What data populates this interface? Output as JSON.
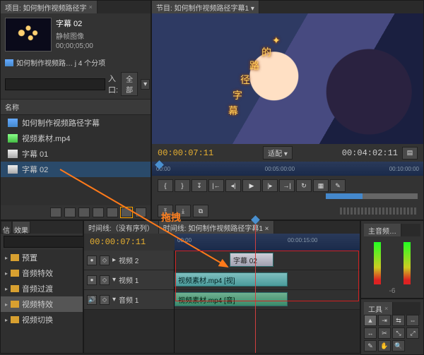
{
  "project": {
    "tab": "项目: 如何制作视频路径字",
    "clip": {
      "name": "字幕 02",
      "kind": "静帧图像",
      "dur": "00;00;05;00"
    },
    "bin_line": "如何制作视频路… j   4 个分项",
    "search_ph": "",
    "entry_label": "入口:",
    "entry_value": "全部",
    "col_name": "名称",
    "assets": [
      {
        "icon": "prj",
        "label": "如何制作视频路径字幕"
      },
      {
        "icon": "vid",
        "label": "视频素材.mp4"
      },
      {
        "icon": "ttl",
        "label": "字幕 01"
      },
      {
        "icon": "ttl",
        "label": "字幕 02",
        "sel": true
      }
    ]
  },
  "program": {
    "tab": "节目: 如何制作视频路径字幕1 ▾",
    "tc_current": "00:00:07:11",
    "fit": "适配",
    "tc_total": "00:04:02:11",
    "ruler": [
      "00:00",
      "00:05:00:00",
      "00:10:00:00"
    ]
  },
  "effects": {
    "tab_left": "信",
    "tab_right": "效果",
    "items": [
      {
        "label": "预置"
      },
      {
        "label": "音频特效"
      },
      {
        "label": "音频过渡"
      },
      {
        "label": "视频特效",
        "sel": true
      },
      {
        "label": "视频切换"
      }
    ]
  },
  "timeline": {
    "tab_empty": "时间线:（没有序列）",
    "tab_active": "时间线: 如何制作视频路径字幕1 ×",
    "tc": "00:00:07:11",
    "ruler": [
      "00:00",
      "00:00:15:00"
    ],
    "tracks": [
      {
        "name": "视频 2",
        "type": "v"
      },
      {
        "name": "视频 1",
        "type": "v"
      },
      {
        "name": "音频 1",
        "type": "a"
      }
    ],
    "clips": {
      "title": "字幕 02",
      "video": "视频素材.mp4 [视]",
      "audio": "视频素材.mp4 [音]"
    }
  },
  "mixer": {
    "tab": "主音频…",
    "db": "-6"
  },
  "tools": {
    "tab": "工具"
  },
  "annotation": {
    "label": "拖拽"
  }
}
